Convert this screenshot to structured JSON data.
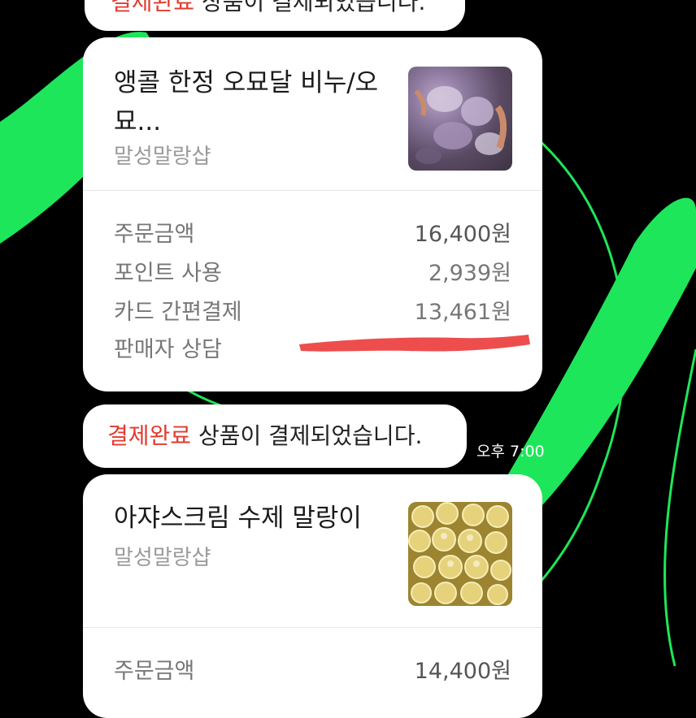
{
  "messages": [
    {
      "status": "결제완료",
      "text": " 상품이 결제되었습니다."
    },
    {
      "status": "결제완료",
      "text": " 상품이 결제되었습니다.",
      "time": "오후 7:00"
    }
  ],
  "orders": [
    {
      "title": "앵콜 한정 오묘달 비누/오묘...",
      "title_line1": "앵콜 한정 오묘달 비누/오",
      "title_line2": "묘...",
      "shop": "말성말랑샵",
      "rows": [
        {
          "label": "주문금액",
          "value": "16,400원"
        },
        {
          "label": "포인트 사용",
          "value": "2,939원"
        },
        {
          "label": "카드 간편결제",
          "value": "13,461원"
        },
        {
          "label": "판매자 상담",
          "value": ""
        }
      ]
    },
    {
      "title": "아쟈스크림 수제 말랑이",
      "shop": "말성말랑샵",
      "rows": [
        {
          "label": "주문금액",
          "value": "14,400원"
        }
      ]
    }
  ],
  "colors": {
    "background": "#000000",
    "accent_green": "#1ee65a",
    "status_red": "#e23a2e",
    "redaction_red": "#ee4d4d"
  }
}
